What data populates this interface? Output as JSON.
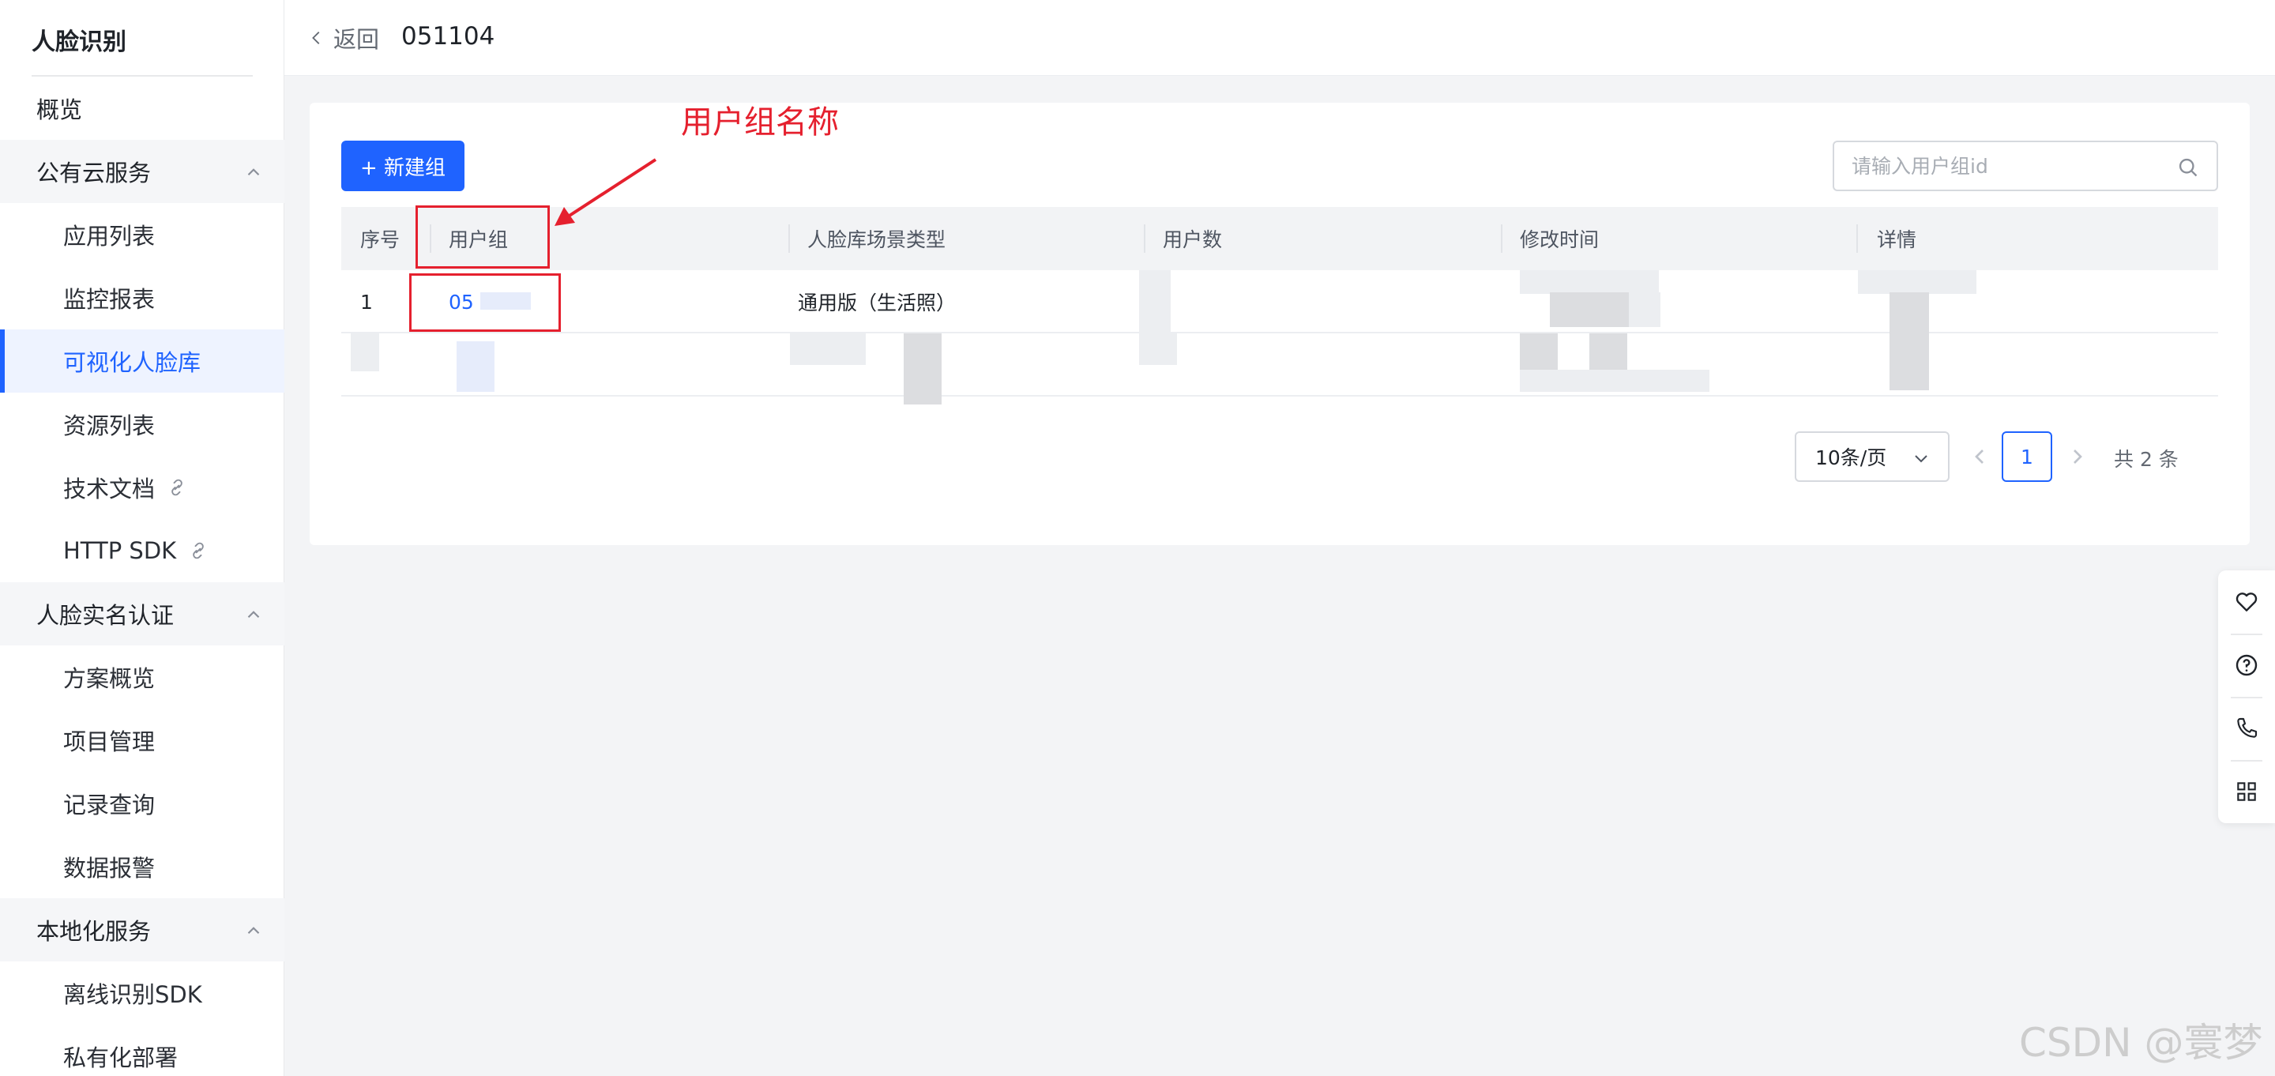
{
  "sidebar": {
    "title": "人脸识别",
    "items": [
      {
        "label": "概览"
      },
      {
        "label": "公有云服务"
      },
      {
        "label": "应用列表"
      },
      {
        "label": "监控报表"
      },
      {
        "label": "可视化人脸库"
      },
      {
        "label": "资源列表"
      },
      {
        "label": "技术文档"
      },
      {
        "label": "HTTP SDK"
      },
      {
        "label": "人脸实名认证"
      },
      {
        "label": "方案概览"
      },
      {
        "label": "项目管理"
      },
      {
        "label": "记录查询"
      },
      {
        "label": "数据报警"
      },
      {
        "label": "本地化服务"
      },
      {
        "label": "离线识别SDK"
      },
      {
        "label": "私有化部署"
      }
    ]
  },
  "header": {
    "back_label": "返回",
    "title": "051104"
  },
  "toolbar": {
    "new_group_label": "+ 新建组",
    "search_placeholder": "请输入用户组id"
  },
  "table": {
    "columns": [
      "序号",
      "用户组",
      "人脸库场景类型",
      "用户数",
      "修改时间",
      "详情"
    ],
    "rows": [
      {
        "index": "1",
        "group": "05",
        "scene": "通用版（生活照）"
      }
    ]
  },
  "pagination": {
    "page_size": "10条/页",
    "current_page": "1",
    "total": "共 2 条"
  },
  "annotation": {
    "label": "用户组名称",
    "color": "#e5202e"
  },
  "watermark": "CSDN @寰梦",
  "colors": {
    "primary": "#1f63ff",
    "annotation": "#e5202e"
  }
}
